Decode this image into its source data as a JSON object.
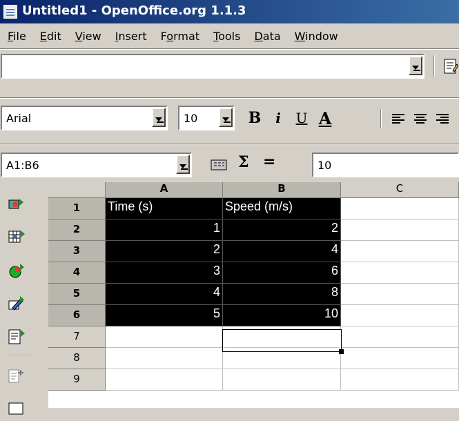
{
  "window": {
    "title": "Untitled1 - OpenOffice.org 1.1.3"
  },
  "menu": [
    {
      "pre": "",
      "u": "F",
      "post": "ile"
    },
    {
      "pre": "",
      "u": "E",
      "post": "dit"
    },
    {
      "pre": "",
      "u": "V",
      "post": "iew"
    },
    {
      "pre": "",
      "u": "I",
      "post": "nsert"
    },
    {
      "pre": "F",
      "u": "o",
      "post": "rmat"
    },
    {
      "pre": "",
      "u": "T",
      "post": "ools"
    },
    {
      "pre": "",
      "u": "D",
      "post": "ata"
    },
    {
      "pre": "",
      "u": "W",
      "post": "indow"
    }
  ],
  "function_bar": {
    "url_value": ""
  },
  "object_bar": {
    "font_name": "Arial",
    "font_size": "10",
    "bold_label": "B",
    "italic_label": "i",
    "underline_label": "U",
    "font_color_label": "A"
  },
  "formula_bar": {
    "name_box": "A1:B6",
    "sum_label": "Σ",
    "equals_label": "=",
    "input_value": "10"
  },
  "sheet": {
    "columns": [
      "A",
      "B",
      "C"
    ],
    "rows": [
      {
        "num": "1",
        "a": "Time (s)",
        "b": "Speed (m/s)",
        "c": ""
      },
      {
        "num": "2",
        "a": "1",
        "b": "2",
        "c": ""
      },
      {
        "num": "3",
        "a": "2",
        "b": "4",
        "c": ""
      },
      {
        "num": "4",
        "a": "3",
        "b": "6",
        "c": ""
      },
      {
        "num": "5",
        "a": "4",
        "b": "8",
        "c": ""
      },
      {
        "num": "6",
        "a": "5",
        "b": "10",
        "c": ""
      },
      {
        "num": "7",
        "a": "",
        "b": "",
        "c": ""
      },
      {
        "num": "8",
        "a": "",
        "b": "",
        "c": ""
      },
      {
        "num": "9",
        "a": "",
        "b": "",
        "c": ""
      }
    ],
    "selected_rows": [
      "1",
      "2",
      "3",
      "4",
      "5",
      "6"
    ],
    "selected_columns": [
      "A",
      "B"
    ]
  },
  "colors": {
    "title_bar": "#0a246a",
    "selection": "#000000",
    "chrome": "#d4d0c8"
  }
}
